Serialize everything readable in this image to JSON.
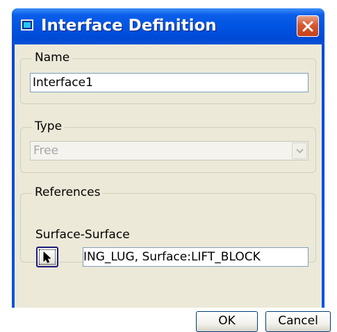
{
  "window": {
    "title": "Interface Definition",
    "title_icon": "dialog-window-icon",
    "close_icon": "close-icon"
  },
  "name_group": {
    "label": "Name",
    "value": "Interface1"
  },
  "type_group": {
    "label": "Type",
    "selected": "Free",
    "disabled": true,
    "arrow_icon": "chevron-down-icon"
  },
  "references_group": {
    "label": "References",
    "subtitle": "Surface-Surface",
    "select_icon": "arrow-cursor-icon",
    "value_visible": "ING_LUG, Surface:LIFT_BLOCK"
  },
  "buttons": {
    "ok": "OK",
    "cancel": "Cancel"
  },
  "colors": {
    "titlebar": "#0054e3",
    "dialog_bg": "#ece9d8",
    "close_button": "#d8582e"
  }
}
